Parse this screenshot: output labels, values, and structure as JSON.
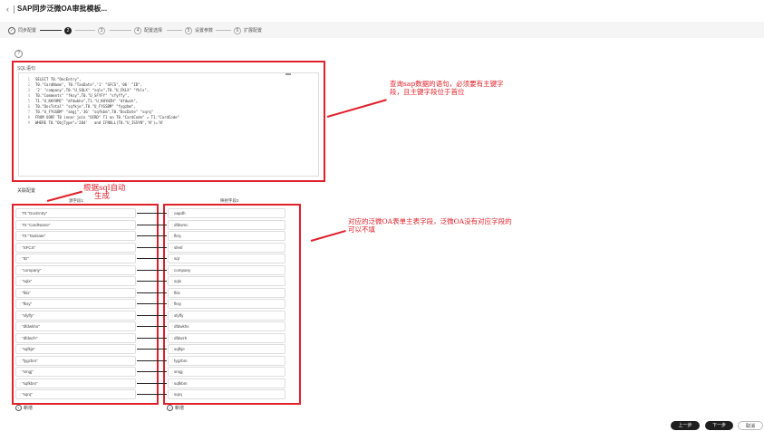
{
  "header": {
    "back_icon": "‹",
    "title": "SAP同步泛微OA审批模板..."
  },
  "steps": [
    {
      "num": "✓",
      "label": "同步配置",
      "state": "done"
    },
    {
      "num": "2",
      "label": "",
      "state": "active"
    },
    {
      "num": "3",
      "label": "",
      "state": "pending"
    },
    {
      "num": "4",
      "label": "配置选择",
      "state": "pending"
    },
    {
      "num": "5",
      "label": "设置参数",
      "state": "pending"
    },
    {
      "num": "6",
      "label": "扩展配置",
      "state": "pending"
    }
  ],
  "help_icon": "?",
  "sql": {
    "label": "SQL语句",
    "lines": [
      {
        "n": "1",
        "code": "SELECT T0.\"DocEntry\","
      },
      {
        "n": "2",
        "code": "T0.\"CardName\", T0.\"TaxDate\",'1' \"SFCS\",'06' \"ID\","
      },
      {
        "n": "3",
        "code": "'2' \"company\",T0.\"U_SQLX\" \"sqlx\",T0.\"U_FKLX\" \"fklx\","
      },
      {
        "n": "4",
        "code": "T0.\"Comments\" \"fksy\",T0.\"U_SFYFY\" \"sfyffy\","
      },
      {
        "n": "5",
        "code": "T1.\"U_KHYHMC\" \"dfdwkhx\",T1.\"U_KHYHZH\" \"dfdwzh\","
      },
      {
        "n": "6",
        "code": "T0.\"DocTotal\" \"sqfkje\",T0.\"U_FYGSBM\" \"fygzbm\","
      },
      {
        "n": "7",
        "code": "T0.\"U_FYGSBM\" \"smgj\",'36' \"sqfkbm\",T0.\"DocDate\" \"sqrq\""
      },
      {
        "n": "8",
        "code": "FROM OORF T0 inner join \"OCRD\" T1 on T0.\"CardCode\" = T1.\"CardCode\""
      },
      {
        "n": "9",
        "code": "WHERE T0.\"ObjType\"='204'   and IFNULL(T0.\"U_ISSYN\",'N')='N'"
      }
    ]
  },
  "annotations": {
    "sql_note": "查询sap数据的语句，必须要有主键字段，且主键字段位于首位",
    "auto_note_1": "根据sql自动",
    "auto_note_2": "生成",
    "target_note": "对应的泛微OA表单主表字段，泛微OA没有对应字段的可以不填"
  },
  "mapping": {
    "title": "关联配置",
    "source_header": "源字段1",
    "target_header": "映射字段2",
    "source_fields": [
      "T0.\"DocEntry\"",
      "T0.\"CardName\"",
      "T0.\"TaxDate\"",
      "\"SFCS\"",
      "\"ID\"",
      "\"company\"",
      "\"sqlx\"",
      "\"fklx\"",
      "\"fksy\"",
      "\"sfyffy\"",
      "\"dfdwkhx\"",
      "\"dfdwzh\"",
      "\"sqfkje\"",
      "\"fygzbm\"",
      "\"smgj\"",
      "\"sqfkbm\"",
      "\"sqrq\""
    ],
    "target_fields": [
      "oapdh",
      "dfdwmc",
      "fkrq",
      "sfesf",
      "sqr",
      "company",
      "sqlx",
      "fklx",
      "fksy",
      "sfyffy",
      "dfdwkhx",
      "dfdwzh",
      "sqfkje",
      "fygzbm",
      "smgj",
      "sqfkbm",
      "sqrq"
    ],
    "add_label": "新增"
  },
  "footer": {
    "prev": "上一步",
    "next": "下一步",
    "cancel": "取消"
  },
  "colors": {
    "annotation": "#e0202a",
    "primary": "#1f1f1f"
  }
}
